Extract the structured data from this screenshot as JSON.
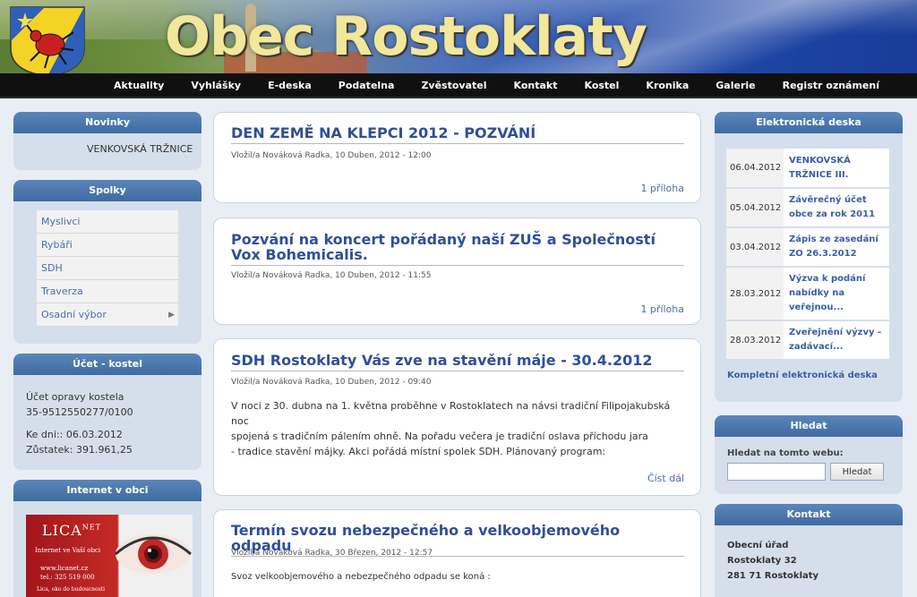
{
  "site": {
    "title": "Obec Rostoklaty"
  },
  "nav": {
    "items": [
      "Aktuality",
      "Vyhlášky",
      "E-deska",
      "Podatelna",
      "Zvěstovatel",
      "Kontakt",
      "Kostel",
      "Kronika",
      "Galerie",
      "Registr oznámení"
    ]
  },
  "left": {
    "novinky": {
      "title": "Novinky",
      "item": "VENKOVSKÁ TRŽNICE"
    },
    "spolky": {
      "title": "Spolky",
      "items": [
        "Myslivci",
        "Rybáři",
        "SDH",
        "Traverza",
        "Osadní výbor"
      ]
    },
    "ucet": {
      "title": "Účet - kostel",
      "line1": "Účet opravy kostela",
      "line2": "35-9512550277/0100",
      "line3": "Ke dni:: 06.03.2012",
      "line4": "Zůstatek: 391.961,25"
    },
    "internet": {
      "title": "Internet v obci",
      "ad": {
        "brand": "LICA",
        "brand_sup": "NET",
        "tagline": "Internet ve Vaší obci",
        "web": "www.licanet.cz",
        "tel": "tel.: 325 519 000",
        "small": "Lica, oko do budoucnosti"
      }
    }
  },
  "posts": [
    {
      "title": "DEN ZEMĚ NA KLEPCI 2012 - POZVÁNÍ",
      "meta": "Vložil/a Nováková Radka, 10 Duben, 2012 - 12:00",
      "more": "1 příloha"
    },
    {
      "title": "Pozvání na koncert pořádaný naší ZUŠ a Společností Vox Bohemicalis.",
      "meta": "Vložil/a Nováková Radka, 10 Duben, 2012 - 11:55",
      "more": "1 příloha"
    },
    {
      "title": "SDH Rostoklaty Vás zve na stavění máje - 30.4.2012",
      "meta": "Vložil/a Nováková Radka, 10 Duben, 2012 - 09:40",
      "body": [
        "V noci z 30. dubna na 1. května proběhne v Rostoklatech na návsi tradiční Filipojakubská noc",
        "spojená s tradičním pálením ohně. Na pořadu večera je tradiční oslava příchodu jara",
        "- tradice stavění májky. Akci pořádá místní spolek SDH. Plánovaný program:"
      ],
      "more": "Číst dál"
    },
    {
      "title": "Termín svozu nebezpečného a velkoobjemového odpadu",
      "meta": "Vložil/a Nováková Radka, 30 Březen, 2012 - 12:57",
      "body": [
        "Svoz velkoobjemového a nebezpečného odpadu se koná :"
      ]
    }
  ],
  "right": {
    "edeska": {
      "title": "Elektronická deska",
      "rows": [
        {
          "date": "06.04.2012",
          "title": "VENKOVSKÁ TRŽNICE III."
        },
        {
          "date": "05.04.2012",
          "title": "Závěrečný účet obce za rok 2011"
        },
        {
          "date": "03.04.2012",
          "title": "Zápis ze zasedání ZO 26.3.2012"
        },
        {
          "date": "28.03.2012",
          "title": "Výzva k podání nabídky na veřejnou..."
        },
        {
          "date": "28.03.2012",
          "title": "Zveřejnění výzvy - zadávací..."
        }
      ],
      "full_link": "Kompletní elektronická deska"
    },
    "search": {
      "title": "Hledat",
      "label": "Hledat na tomto webu:",
      "value": "",
      "button": "Hledat"
    },
    "kontakt": {
      "title": "Kontakt",
      "line1": "Obecní úřad",
      "line2": "Rostoklaty 32",
      "line3": "281 71 Rostoklaty"
    }
  },
  "colors": {
    "nav_bg": "#101010",
    "box_head": "#4a76ae",
    "box_bg": "#d5dfec",
    "link": "#3a5ea8",
    "title_yellow": "#f2e79a"
  }
}
